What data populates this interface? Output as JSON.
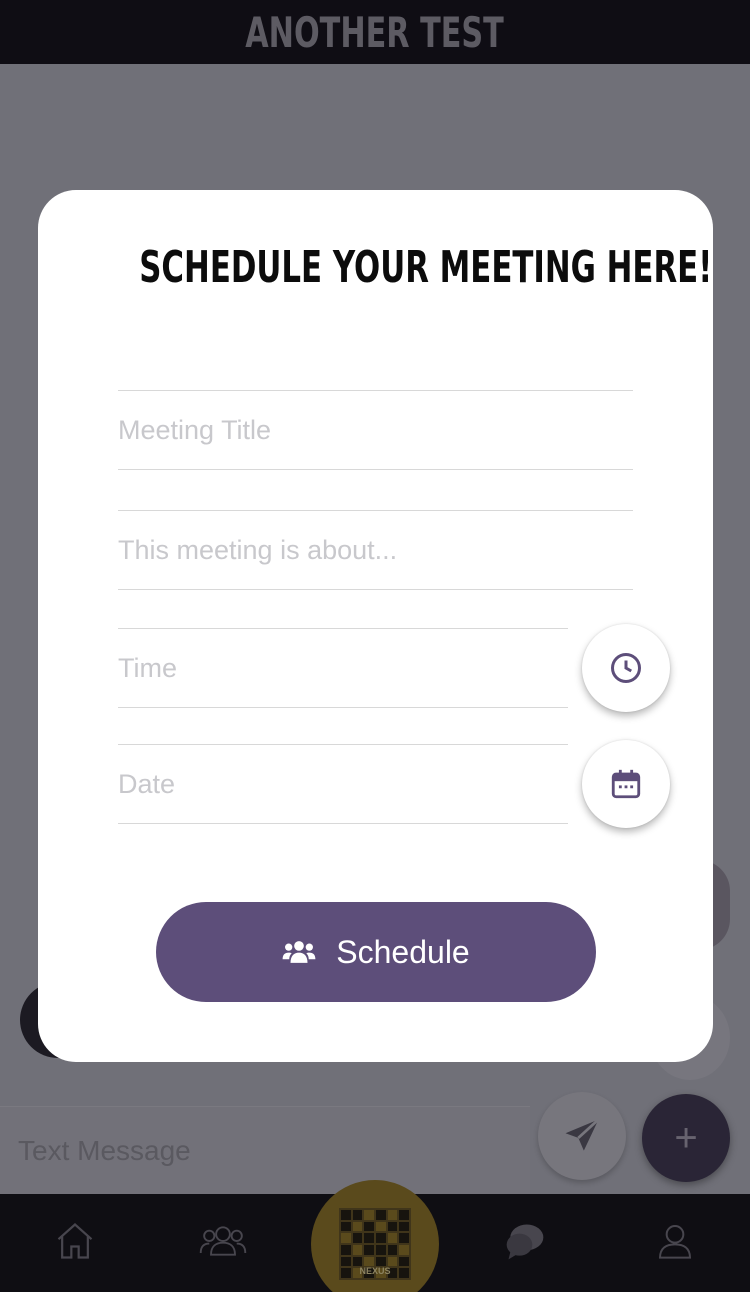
{
  "app": {
    "title": "ANOTHER TEST"
  },
  "composer": {
    "placeholder": "Text Message"
  },
  "nav": {
    "center_label": "NEXUS",
    "items": [
      "home-icon",
      "people-icon",
      "qr-code",
      "chat-icon",
      "profile-icon"
    ]
  },
  "modal": {
    "title": "SCHEDULE YOUR MEETING HERE!",
    "fields": {
      "title_placeholder": "Meeting Title",
      "about_placeholder": "This meeting is about...",
      "time_placeholder": "Time",
      "date_placeholder": "Date"
    },
    "schedule_label": "Schedule"
  },
  "colors": {
    "accent": "#5d4e7a",
    "overlay": "#707078",
    "header_bg": "#0f0d14"
  }
}
